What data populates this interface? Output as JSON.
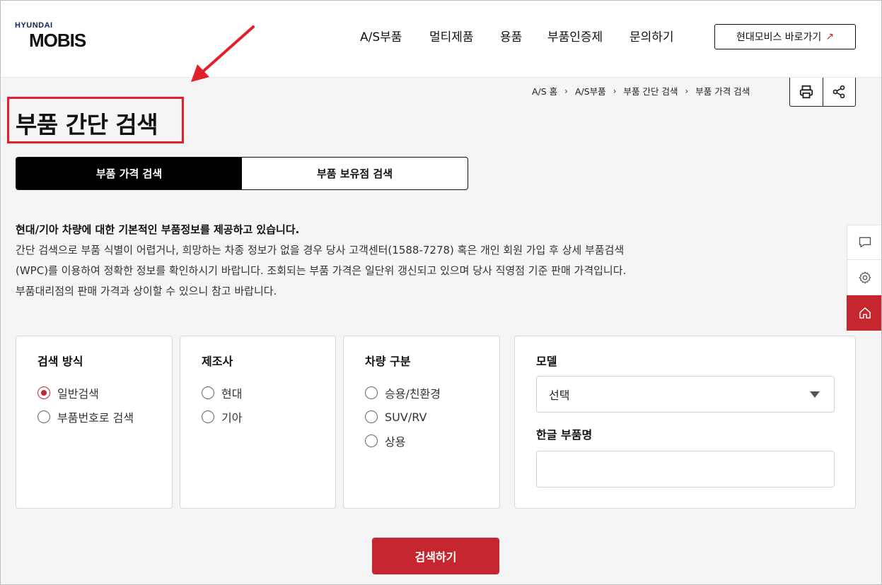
{
  "header": {
    "logo_top": "HYUNDAI",
    "logo_main": "MOBIS",
    "nav": [
      "A/S부품",
      "멀티제품",
      "용품",
      "부품인증제",
      "문의하기"
    ],
    "shortcut_label": "현대모비스 바로가기",
    "shortcut_icon": "↗"
  },
  "breadcrumb": [
    "A/S 홈",
    "A/S부품",
    "부품 간단 검색",
    "부품 가격 검색"
  ],
  "breadcrumb_sep": "›",
  "page_title": "부품 간단 검색",
  "tabs": [
    "부품 가격 검색",
    "부품 보유점 검색"
  ],
  "description": {
    "lead": "현대/기아 차량에 대한 기본적인 부품정보를 제공하고 있습니다.",
    "line1": "간단 검색으로 부품 식별이 어렵거나, 희망하는 차종 정보가 없을 경우 당사 고객센터(1588-7278) 혹은 개인 회원 가입 후 상세 부품검색",
    "line2": "(WPC)를 이용하여 정확한 정보를 확인하시기 바랍니다. 조회되는 부품 가격은 일단위 갱신되고 있으며 당사 직영점 기준 판매 가격입니다.",
    "line3": "부품대리점의 판매 가격과 상이할 수 있으니 참고 바랍니다."
  },
  "panels": {
    "method": {
      "title": "검색 방식",
      "options": [
        "일반검색",
        "부품번호로 검색"
      ],
      "selected": "일반검색"
    },
    "maker": {
      "title": "제조사",
      "options": [
        "현대",
        "기아"
      ]
    },
    "vehicle": {
      "title": "차량 구분",
      "options": [
        "승용/친환경",
        "SUV/RV",
        "상용"
      ]
    },
    "model": {
      "title": "모델",
      "select_value": "선택",
      "name_title": "한글 부품명",
      "name_value": ""
    }
  },
  "search_button": "검색하기",
  "colors": {
    "accent": "#c6262d",
    "annotation": "#e3202a",
    "tab_active_bg": "#000000"
  },
  "icons": {
    "print": "printer-icon",
    "share": "share-icon",
    "chat": "chat-icon",
    "settings": "gear-icon",
    "home": "home-icon"
  }
}
